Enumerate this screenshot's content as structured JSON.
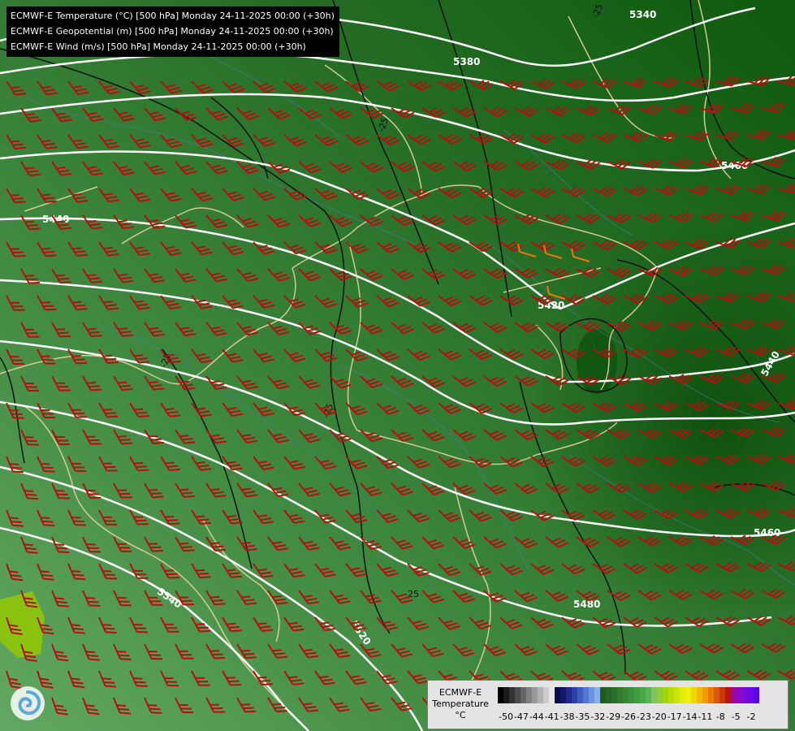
{
  "header": {
    "lines": [
      "ECMWF-E Temperature (°C) [500 hPa] Monday 24-11-2025 00:00 (+30h)",
      "ECMWF-E Geopotential (m) [500 hPa] Monday 24-11-2025 00:00 (+30h)",
      "ECMWF-E Wind (m/s) [500 hPa] Monday 24-11-2025 00:00 (+30h)"
    ]
  },
  "legend": {
    "title_line1": "ECMWF-E",
    "title_line2": "Temperature",
    "title_line3": "°C",
    "tick_labels": [
      "-50",
      "-47",
      "-44",
      "-41",
      "-38",
      "-35",
      "-32",
      "-29",
      "-26",
      "-23",
      "-20",
      "-17",
      "-14",
      "-11",
      "-8",
      "-5",
      "-2"
    ],
    "colors": [
      "#000000",
      "#1a1a1a",
      "#333333",
      "#4d4d4d",
      "#666666",
      "#808080",
      "#999999",
      "#b3b3b3",
      "#cccccc",
      "#e6e6e6",
      "#0b0b4a",
      "#14146b",
      "#1f2a8a",
      "#2a40a5",
      "#3e5cbf",
      "#5478d2",
      "#6e95df",
      "#8ab0ea",
      "#1f5a1f",
      "#246524",
      "#2a702a",
      "#307b30",
      "#368636",
      "#3c913c",
      "#429c42",
      "#48a748",
      "#5ab35a",
      "#7fc35a",
      "#8fcc3a",
      "#a3d40a",
      "#b7dc0a",
      "#cce40a",
      "#e0ec0a",
      "#f0f00a",
      "#f2d80a",
      "#f0b90a",
      "#ee9a0a",
      "#e87a0a",
      "#d85a0a",
      "#c8380a",
      "#b8160a",
      "#9a0a9a",
      "#8a0ac8",
      "#7a0ae0",
      "#6a0ae8",
      "#5a0ae0"
    ]
  },
  "contours": {
    "geopotential_labels": [
      "5340",
      "5380",
      "5400",
      "5420",
      "5440",
      "5440",
      "5460",
      "5480",
      "5520",
      "5540"
    ],
    "temperature_labels": [
      "-25",
      "-25",
      "-25",
      "-25",
      "-25"
    ]
  },
  "logo": {
    "icon": "meteo-logo-icon"
  }
}
